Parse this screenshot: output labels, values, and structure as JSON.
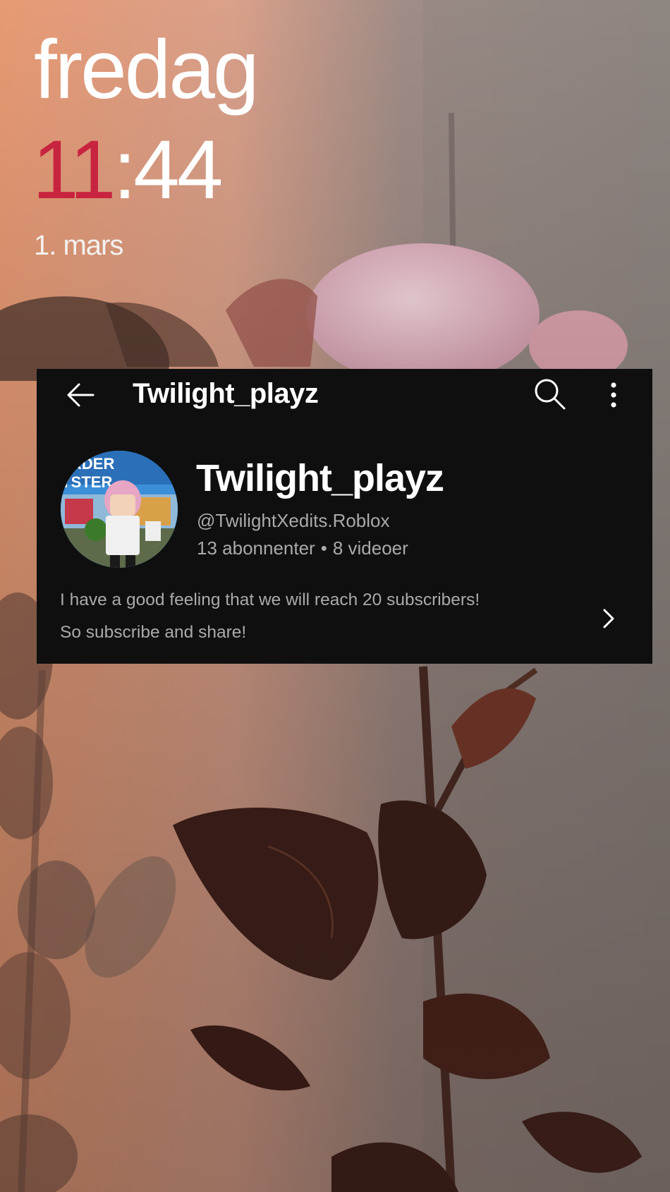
{
  "lock_screen": {
    "day": "fredag",
    "time_hour": "11",
    "time_separator": ":",
    "time_minute": "44",
    "date": "1. mars",
    "hour_color": "#c8243f"
  },
  "topbar": {
    "title": "Twilight_playz",
    "back_icon": "arrow-left-icon",
    "search_icon": "search-icon",
    "more_icon": "more-vertical-icon"
  },
  "channel": {
    "avatar_text_top": "RDER",
    "avatar_text_bottom": "YSTER",
    "name": "Twilight_playz",
    "handle": "@TwilightXedits.Roblox",
    "subscribers": "13 abonnenter",
    "separator": "•",
    "videos": "8 videoer",
    "description_line1": "I have a good feeling that we will reach 20 subscribers!",
    "description_line2": "So subscribe and share!",
    "expand_icon": "chevron-right-icon"
  }
}
